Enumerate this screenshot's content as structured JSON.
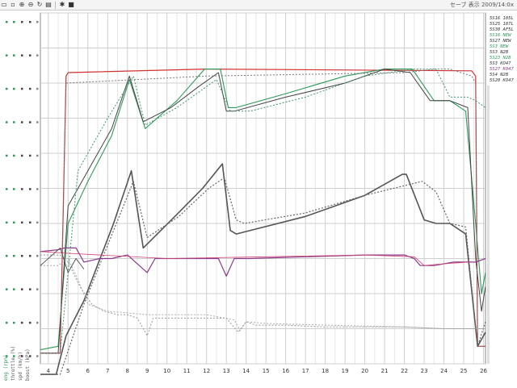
{
  "toolbar": {
    "buttons": [
      {
        "name": "open-icon",
        "glyph": "▭"
      },
      {
        "name": "select-icon",
        "glyph": "▫"
      },
      {
        "name": "zoom-in-icon",
        "glyph": "⊕"
      },
      {
        "name": "zoom-out-icon",
        "glyph": "⊖"
      },
      {
        "name": "refresh-icon",
        "glyph": "↻"
      },
      {
        "name": "save-icon",
        "glyph": "▤"
      },
      {
        "name": "options-icon",
        "glyph": "✱"
      },
      {
        "name": "stop-icon",
        "glyph": "■"
      }
    ],
    "status_text": "セーブ 表示  2009/14:0x"
  },
  "chart_data": {
    "type": "line",
    "xlim": [
      3.6,
      26.1
    ],
    "xticks": [
      4,
      5,
      6,
      7,
      8,
      9,
      10,
      11,
      12,
      13,
      14,
      15,
      16,
      17,
      18,
      19,
      20,
      21,
      22,
      23,
      24,
      25,
      26
    ],
    "ylim": [
      0,
      100
    ],
    "grid": true,
    "legend_position": "right",
    "left_axis_titles": [
      "eng (rpm)",
      "throttle (%)",
      "spd (km/h)",
      "boost (kPa)"
    ],
    "series": [
      {
        "color": "#d03030",
        "dash": "",
        "width": 1.2,
        "x": [
          3.6,
          4.6,
          4.9,
          5.0,
          12.0,
          25.4,
          25.6,
          25.7,
          26.1
        ],
        "y": [
          3,
          3,
          82,
          83,
          84,
          83.5,
          82,
          5,
          5
        ]
      },
      {
        "color": "#2e9a5a",
        "dash": "",
        "width": 1.1,
        "x": [
          3.6,
          4.5,
          5.0,
          6.0,
          7.2,
          8.1,
          8.9,
          10.5,
          11.9,
          12.7,
          13.1,
          13.5,
          16,
          19,
          21,
          22.4,
          23.5,
          24.3,
          25.1,
          25.6,
          25.9,
          26.1
        ],
        "y": [
          4,
          5,
          40,
          52,
          65,
          81,
          67,
          75,
          84,
          84,
          73,
          73,
          77,
          82,
          84,
          84,
          75,
          75,
          72,
          40,
          20,
          26
        ]
      },
      {
        "color": "#444444",
        "dash": "",
        "width": 1.0,
        "x": [
          3.6,
          4.5,
          5.0,
          6.0,
          7.2,
          8.1,
          8.8,
          10.2,
          11.6,
          12.6,
          13.0,
          13.4,
          16,
          19,
          21,
          22.3,
          23.3,
          24.3,
          25.2,
          25.6,
          25.9,
          26.1
        ],
        "y": [
          3,
          3,
          45,
          55,
          67,
          82,
          69,
          73,
          79,
          83,
          72,
          72,
          76,
          80,
          84,
          83,
          75,
          75,
          73,
          30,
          15,
          22
        ]
      },
      {
        "color": "#3d9a6a",
        "dash": "2,2",
        "width": 1.0,
        "x": [
          3.6,
          4.6,
          5.5,
          7.0,
          8.3,
          8.9,
          10.5,
          12.5,
          13.2,
          14.2,
          17,
          20,
          22.5,
          23.6,
          24.3,
          25.2,
          25.6,
          26.1
        ],
        "y": [
          3,
          3,
          55,
          70,
          82,
          68,
          73,
          81,
          72,
          72,
          76,
          82,
          84,
          84,
          76,
          76,
          75,
          73
        ]
      },
      {
        "color": "#777777",
        "dash": "2,2",
        "width": 1.0,
        "x": [
          3.6,
          4.6,
          4.9,
          12.0,
          22.0,
          23.6,
          24.3,
          25.4,
          25.6,
          25.7,
          26.1
        ],
        "y": [
          3,
          3,
          80,
          82,
          83,
          84,
          84,
          82,
          80,
          5,
          5
        ]
      },
      {
        "color": "#555555",
        "dash": "",
        "width": 1.6,
        "x": [
          3.6,
          4.4,
          4.9,
          5.8,
          7.3,
          8.2,
          8.8,
          10.4,
          11.8,
          12.8,
          13.2,
          13.5,
          17.0,
          20.0,
          21.9,
          22.1,
          23.0,
          23.6,
          24.3,
          25.1,
          25.7,
          26.1
        ],
        "y": [
          -3,
          -3,
          8,
          18,
          40,
          55,
          33,
          42,
          50,
          57,
          38,
          37,
          42,
          48,
          54,
          54,
          41,
          40,
          40,
          37,
          5,
          9
        ]
      },
      {
        "color": "#666666",
        "dash": "2,2",
        "width": 1.2,
        "x": [
          3.6,
          4.6,
          5.8,
          7.3,
          8.3,
          9.0,
          10.6,
          12.1,
          12.9,
          13.5,
          13.9,
          17.0,
          20.0,
          22.9,
          23.6,
          24.3,
          25.1,
          25.7,
          26.1
        ],
        "y": [
          -3,
          -3,
          17,
          38,
          52,
          36,
          42,
          50,
          53,
          41,
          40,
          43,
          48,
          52,
          49,
          40,
          39,
          5,
          12
        ]
      },
      {
        "color": "#8a3a8a",
        "dash": "",
        "width": 1.2,
        "x": [
          3.6,
          4.5,
          4.8,
          5.4,
          5.8,
          6.6,
          7.2,
          8.0,
          8.6,
          9.0,
          9.4,
          10.2,
          12.0,
          12.6,
          13.0,
          13.4,
          14.2,
          17.0,
          20.0,
          22.0,
          22.5,
          22.8,
          23.5,
          24.5,
          25.2,
          25.6,
          26.1
        ],
        "y": [
          32,
          32.5,
          33,
          33,
          29,
          30,
          30,
          31,
          28,
          26,
          30,
          30,
          30,
          30,
          25,
          30,
          30,
          30.5,
          31,
          31,
          30,
          28,
          28,
          29,
          29,
          29,
          30
        ]
      },
      {
        "color": "#d04070",
        "dash": "",
        "width": 0.8,
        "x": [
          3.6,
          5,
          10,
          15,
          20,
          22.5,
          23,
          24,
          25.3
        ],
        "y": [
          32,
          31.5,
          30,
          30.5,
          31,
          30.5,
          28,
          28.5,
          29
        ]
      },
      {
        "color": "#999999",
        "dash": "2,2",
        "width": 1.0,
        "x": [
          3.6,
          4.6,
          5.0,
          5.6,
          6.2,
          6.8,
          7.5,
          8.0,
          8.5,
          9.0,
          9.3,
          10.0,
          12.0,
          13.0,
          13.6,
          14.0,
          14.5,
          16.0,
          18.0,
          20.0,
          22.0,
          24.0,
          25.5,
          26.1
        ],
        "y": [
          31,
          31,
          29,
          22,
          17,
          15,
          14,
          14,
          13,
          8,
          13,
          13,
          13,
          13,
          9,
          12,
          11,
          11,
          10.5,
          10.5,
          10.5,
          10,
          10,
          10
        ]
      },
      {
        "color": "#aaaaaa",
        "dash": "2,2",
        "width": 1.0,
        "x": [
          3.6,
          4.5,
          5.0,
          5.5,
          6.0,
          7.0,
          8.0,
          9.0,
          10,
          12,
          13.4,
          13.7,
          14.0,
          15,
          18,
          22,
          24,
          25.5,
          26.1
        ],
        "y": [
          28,
          28,
          30,
          24,
          17,
          15,
          14.5,
          14,
          14,
          14,
          12.5,
          9.5,
          12,
          11.5,
          11,
          10.5,
          10,
          10,
          10
        ]
      },
      {
        "color": "#4a4a4a",
        "dash": "",
        "width": 0.9,
        "x": [
          3.6,
          4.6,
          5.0,
          5.4,
          5.8
        ],
        "y": [
          28,
          33,
          26,
          30,
          27
        ]
      }
    ],
    "legend": [
      {
        "text": "5S16 185L",
        "color": "#333333"
      },
      {
        "text": "5S25 187L",
        "color": "#333333"
      },
      {
        "text": "5S30 AF5L",
        "color": "#333333"
      },
      {
        "text": "5S16 NEW",
        "color": "#2e9a5a"
      },
      {
        "text": "5S27 NEW",
        "color": "#333333"
      },
      {
        "text": "5S3 NEW",
        "color": "#2e9a5a"
      },
      {
        "text": "5S3 N2B",
        "color": "#333333"
      },
      {
        "text": "5S23 N2B",
        "color": "#2e9a5a"
      },
      {
        "text": "5S3 KO47",
        "color": "#333333"
      },
      {
        "text": "5S27 KO47",
        "color": "#8a3a8a"
      },
      {
        "text": "5S4 N2B",
        "color": "#333333"
      },
      {
        "text": "5S20 KO47",
        "color": "#333333"
      }
    ]
  }
}
